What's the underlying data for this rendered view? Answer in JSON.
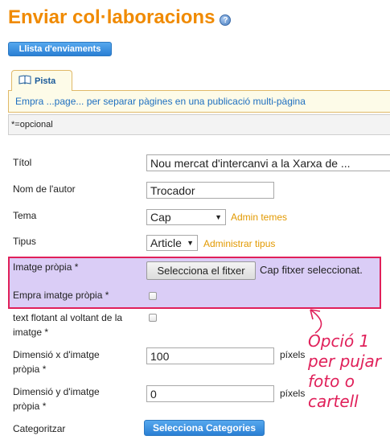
{
  "page": {
    "title": "Enviar col·laboracions",
    "help_icon_glyph": "?",
    "list_button": "Llista d'enviaments"
  },
  "tip": {
    "tab_label": "Pista",
    "text": "Empra ...page... per separar pàgines en una publicació multi-pàgina"
  },
  "optional_note": "*=opcional",
  "form": {
    "title_label": "Títol",
    "title_value": "Nou mercat d'intercanvi a la Xarxa de ...",
    "author_label": "Nom de l'autor",
    "author_value": "Trocador",
    "topic_label": "Tema",
    "topic_value": "Cap",
    "topic_admin_link": "Admin temes",
    "type_label": "Tipus",
    "type_value": "Article",
    "type_admin_link": "Administrar tipus",
    "own_image_label": "Imatge pròpia *",
    "file_button": "Selecciona el fitxer",
    "file_status": "Cap fitxer seleccionat.",
    "use_own_image_label": "Empra imatge pròpia *",
    "float_text_label_line1": "text flotant al voltant de la",
    "float_text_label_line2": "imatge *",
    "dim_x_label_line1": "Dimensió x d'imatge",
    "dim_x_label_line2": "pròpia *",
    "dim_x_value": "100",
    "dim_x_units": "píxels",
    "dim_y_label_line1": "Dimensió y d'imatge",
    "dim_y_label_line2": "pròpia *",
    "dim_y_value": "0",
    "dim_y_units": "píxels",
    "categorize_label": "Categoritzar",
    "categories_button": "Selecciona Categories"
  },
  "annotation": {
    "line1": "Opció 1",
    "line2": "per pujar",
    "line3": "foto o",
    "line4": "cartell"
  },
  "colors": {
    "title": "#f08a00",
    "highlight_fill": "#dacdf6",
    "annotation": "#e0205a",
    "button_blue": "#2a7fd4"
  }
}
